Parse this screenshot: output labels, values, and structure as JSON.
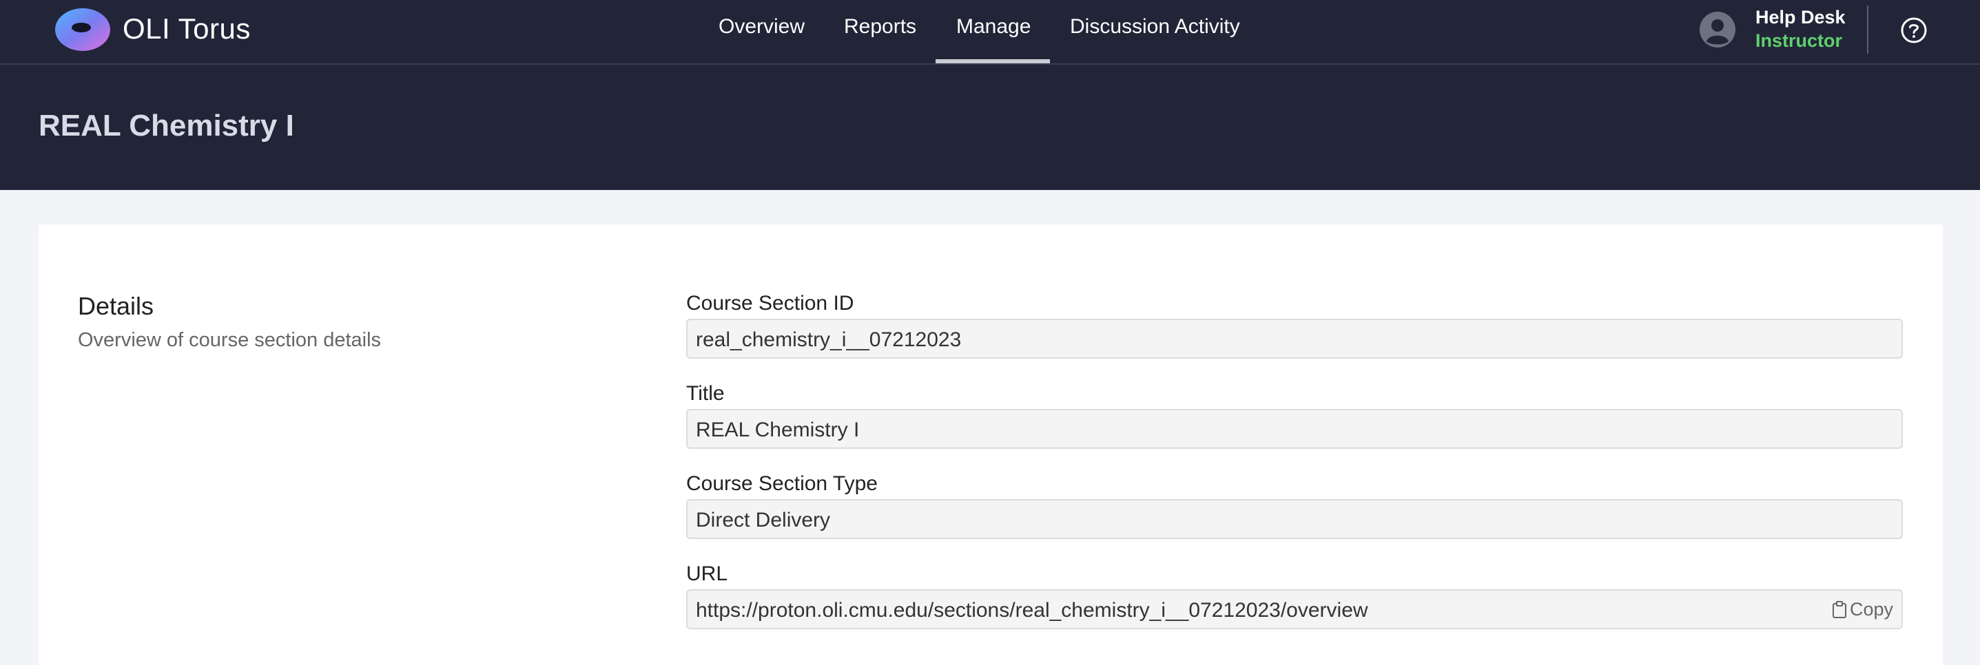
{
  "app": {
    "brand_bold": "OLI",
    "brand_light": " Torus"
  },
  "nav": {
    "items": [
      {
        "label": "Overview"
      },
      {
        "label": "Reports"
      },
      {
        "label": "Manage",
        "active": true
      },
      {
        "label": "Discussion Activity"
      }
    ]
  },
  "user": {
    "name": "Help Desk",
    "role": "Instructor"
  },
  "page": {
    "title": "REAL Chemistry I"
  },
  "details": {
    "title": "Details",
    "subtitle": "Overview of course section details",
    "fields": [
      {
        "label": "Course Section ID",
        "value": "real_chemistry_i__07212023"
      },
      {
        "label": "Title",
        "value": "REAL Chemistry I"
      },
      {
        "label": "Course Section Type",
        "value": "Direct Delivery"
      },
      {
        "label": "URL",
        "value": "https://proton.oli.cmu.edu/sections/real_chemistry_i__07212023/overview",
        "copy_label": "Copy"
      }
    ]
  },
  "colors": {
    "header_bg": "#222538",
    "role_green": "#5fd06e",
    "page_bg": "#f3f4f7"
  },
  "icons": {
    "logo": "torus-logo-icon",
    "avatar": "user-avatar-icon",
    "help": "help-circle-icon",
    "copy": "clipboard-icon"
  }
}
